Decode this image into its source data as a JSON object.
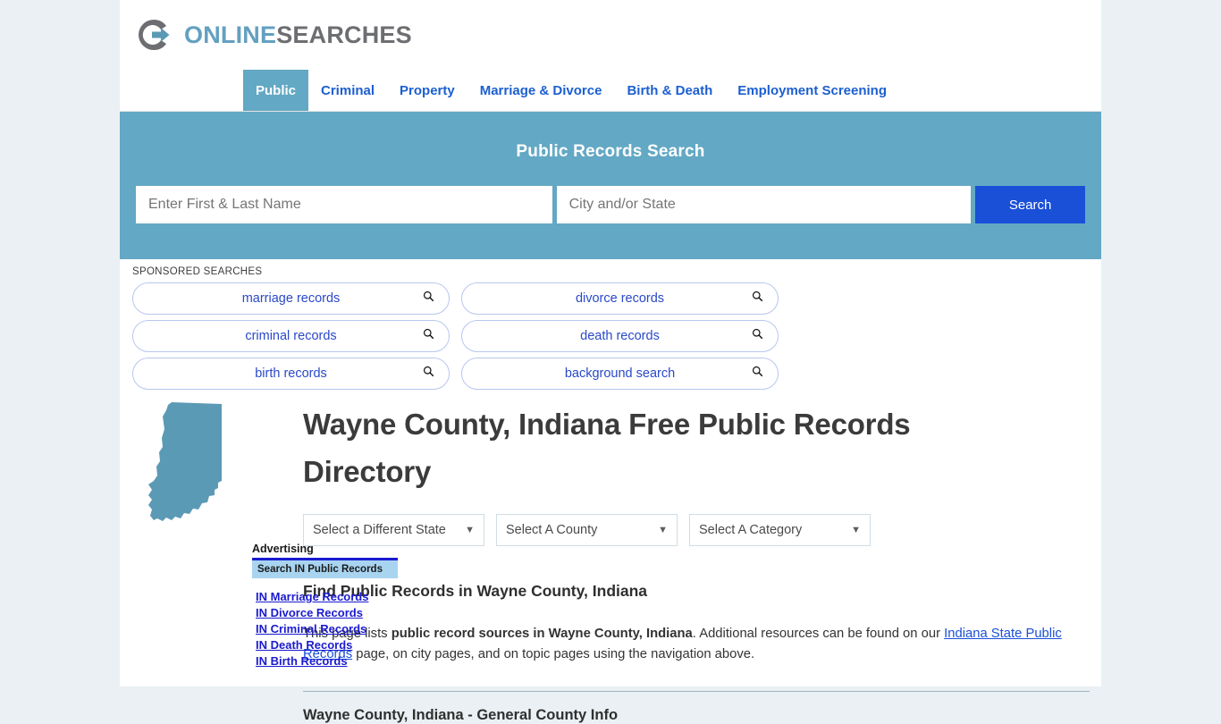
{
  "brand": {
    "online": "ONLINE",
    "searches": "SEARCHES",
    "icon": "circle-arrow-logo"
  },
  "nav": {
    "tabs": [
      {
        "label": "Public",
        "active": true
      },
      {
        "label": "Criminal",
        "active": false
      },
      {
        "label": "Property",
        "active": false
      },
      {
        "label": "Marriage & Divorce",
        "active": false
      },
      {
        "label": "Birth & Death",
        "active": false
      },
      {
        "label": "Employment Screening",
        "active": false
      }
    ]
  },
  "search": {
    "title": "Public Records Search",
    "name_placeholder": "Enter First & Last Name",
    "name_value": "",
    "city_placeholder": "City and/or State",
    "city_value": "",
    "button_label": "Search",
    "band_color": "#63a8c4",
    "button_color": "#1a4fd8"
  },
  "sponsored": {
    "label": "SPONSORED SEARCHES",
    "items": [
      {
        "label": "marriage records"
      },
      {
        "label": "divorce records"
      },
      {
        "label": "criminal records"
      },
      {
        "label": "death records"
      },
      {
        "label": "birth records"
      },
      {
        "label": "background search"
      }
    ]
  },
  "hero": {
    "map_name": "indiana-state-outline",
    "map_color": "#5b9ab5",
    "title": "Wayne County, Indiana Free Public Records Directory"
  },
  "selects": [
    {
      "label": "Select a Different State",
      "name": "state-select"
    },
    {
      "label": "Select A County",
      "name": "county-select"
    },
    {
      "label": "Select A Category",
      "name": "category-select"
    }
  ],
  "content": {
    "heading": "Find Public Records in Wayne County, Indiana",
    "para_part1": "This page lists ",
    "para_bold": "public record sources in Wayne County, Indiana",
    "para_part2": ". Additional resources can be found on our ",
    "para_link": "Indiana State Public Records",
    "para_part3": " page, on city pages, and on topic pages using the navigation above.",
    "subheading": "Wayne County, Indiana - General County Info"
  },
  "sidebar": {
    "ad_title": "Advertising",
    "ad_bar": "Search IN Public Records",
    "links": [
      "IN Marriage Records",
      "IN Divorce Records",
      "IN Criminal Records",
      "IN Death Records",
      "IN Birth Records"
    ]
  }
}
